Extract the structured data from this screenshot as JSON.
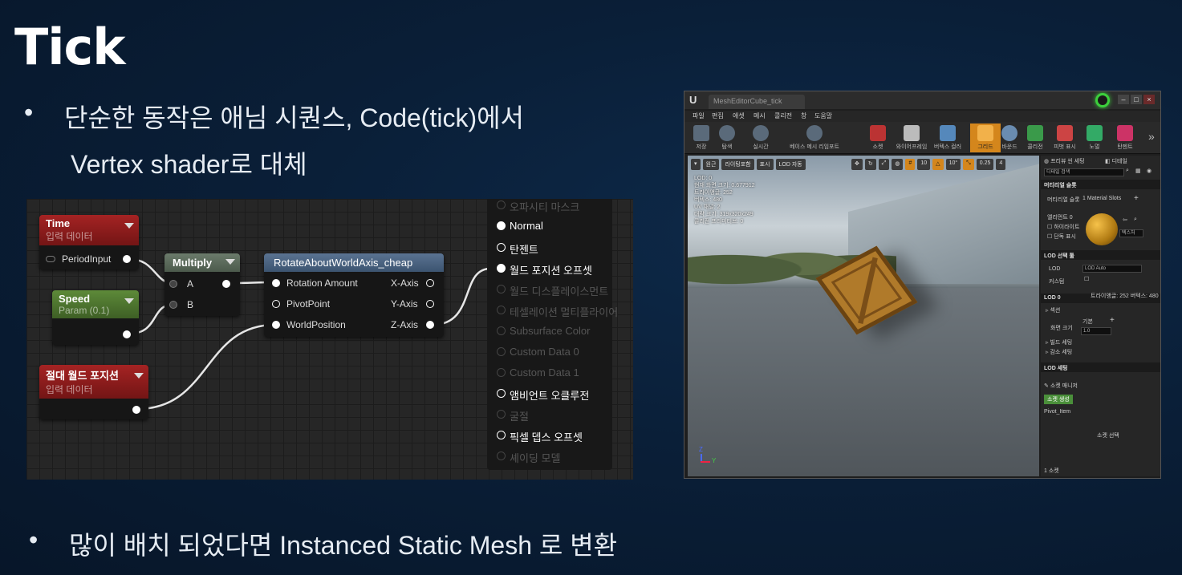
{
  "slide": {
    "title": "Tick",
    "bullet1_line1": "단순한 동작은 애님 시퀀스, Code(tick)에서",
    "bullet1_line2": "Vertex shader로 대체",
    "bullet2": "많이 배치 되었다면 Instanced Static Mesh 로 변환",
    "bullet_glyph": "•"
  },
  "graph": {
    "nodes": {
      "time": {
        "name": "Time",
        "sub": "입력 데이터",
        "pin": "PeriodInput"
      },
      "speed": {
        "name": "Speed",
        "sub": "Param (0.1)"
      },
      "abs_world": {
        "name": "절대 월드 포지션",
        "sub": "입력 데이터"
      },
      "multiply": {
        "name": "Multiply",
        "pin_a": "A",
        "pin_b": "B"
      },
      "rotate": {
        "name": "RotateAboutWorldAxis_cheap",
        "in_rotation": "Rotation Amount",
        "in_pivot": "PivotPoint",
        "in_world": "WorldPosition",
        "out_x": "X-Axis",
        "out_y": "Y-Axis",
        "out_z": "Z-Axis"
      }
    },
    "result_pins": [
      {
        "label": "오파시티 마스크",
        "active": false
      },
      {
        "label": "Normal",
        "active": true
      },
      {
        "label": "탄젠트",
        "active": true
      },
      {
        "label": "월드 포지션 오프셋",
        "active": true
      },
      {
        "label": "월드 디스플레이스먼트",
        "active": false
      },
      {
        "label": "테셀레이션 멀티플라이어",
        "active": false
      },
      {
        "label": "Subsurface Color",
        "active": false
      },
      {
        "label": "Custom Data 0",
        "active": false
      },
      {
        "label": "Custom Data 1",
        "active": false
      },
      {
        "label": "앰비언트 오클루전",
        "active": true
      },
      {
        "label": "굴절",
        "active": false
      },
      {
        "label": "픽셀 뎁스 오프셋",
        "active": true
      },
      {
        "label": "셰이딩 모델",
        "active": false
      }
    ],
    "colors": {
      "red_header": "#a52323",
      "green_header": "#5d8a39",
      "blue_header": "#5a7392",
      "wire": "#e6e6e6"
    }
  },
  "editor": {
    "logo": "U",
    "tab_title": "MeshEditorCube_tick",
    "menu": [
      "파일",
      "편집",
      "애셋",
      "메시",
      "콜리전",
      "창",
      "도움말"
    ],
    "toolbar": [
      {
        "label": "저장",
        "icon": "save-icon"
      },
      {
        "label": "탐색",
        "icon": "browse-icon"
      },
      {
        "label": "실시간",
        "icon": "realtime-icon"
      },
      {
        "label": "베이스 메시 리임포트",
        "icon": "reimport-icon"
      },
      {
        "label": "소켓",
        "icon": "socket-icon"
      },
      {
        "label": "와이어프레임",
        "icon": "wireframe-icon"
      },
      {
        "label": "버텍스 컬러",
        "icon": "vertex-color-icon"
      },
      {
        "label": "그리드",
        "icon": "grid-icon"
      },
      {
        "label": "바운드",
        "icon": "bounds-icon"
      },
      {
        "label": "콜리전",
        "icon": "collision-icon"
      },
      {
        "label": "피벗 표시",
        "icon": "pivot-icon"
      },
      {
        "label": "노멀",
        "icon": "normal-icon"
      },
      {
        "label": "탄젠트",
        "icon": "tangent-icon"
      }
    ],
    "toolbar_more": "»",
    "viewport_bar": [
      "원근",
      "라이팅포함",
      "표시",
      "LOD 자동"
    ],
    "viewport_snap": [
      "10",
      "10°",
      "0.25",
      "4"
    ],
    "viewport_stats": [
      "LOD: 0",
      "현재 화면 크기: 0.677912",
      "트라이앵글: 252",
      "버텍스: 480",
      "UV 채널: 2",
      "대략 크기: 319x320x249",
      "콜리전 프리미티브: 0"
    ],
    "axes": {
      "x": "Y",
      "z": "Z"
    },
    "details": {
      "tabs": [
        "프리뷰 씬 세팅",
        "디테일"
      ],
      "search_placeholder": "디테일 검색",
      "material_slots_header": "머티리얼 슬롯",
      "material_slots_label": "머티리얼 슬롯",
      "material_slots_value": "1 Material Slots",
      "element_label": "엘리먼트 0",
      "highlight": "하이라이트",
      "isolate": "단독 표시",
      "texture_btn": "텍스처",
      "lod_picker_header": "LOD 선택 툴",
      "lod_label": "LOD",
      "lod_value": "LOD Auto",
      "custom_label": "커스텀",
      "lod0_header": "LOD 0",
      "tri_info": "트라이앵글: 252   버텍스: 480",
      "section_label": "섹션",
      "screen_size_label": "화면 크기",
      "screen_base": "기본",
      "screen_value": "1.0",
      "build_settings": "빌드 세팅",
      "reduction_settings": "감소 세팅",
      "lod_settings_header": "LOD 세팅",
      "socket_manager": "소켓 매니저",
      "create_socket": "소켓 생성",
      "socket_item": "Pivot_Item",
      "socket_select": "소켓 선택",
      "socket_count": "1 소켓"
    }
  }
}
